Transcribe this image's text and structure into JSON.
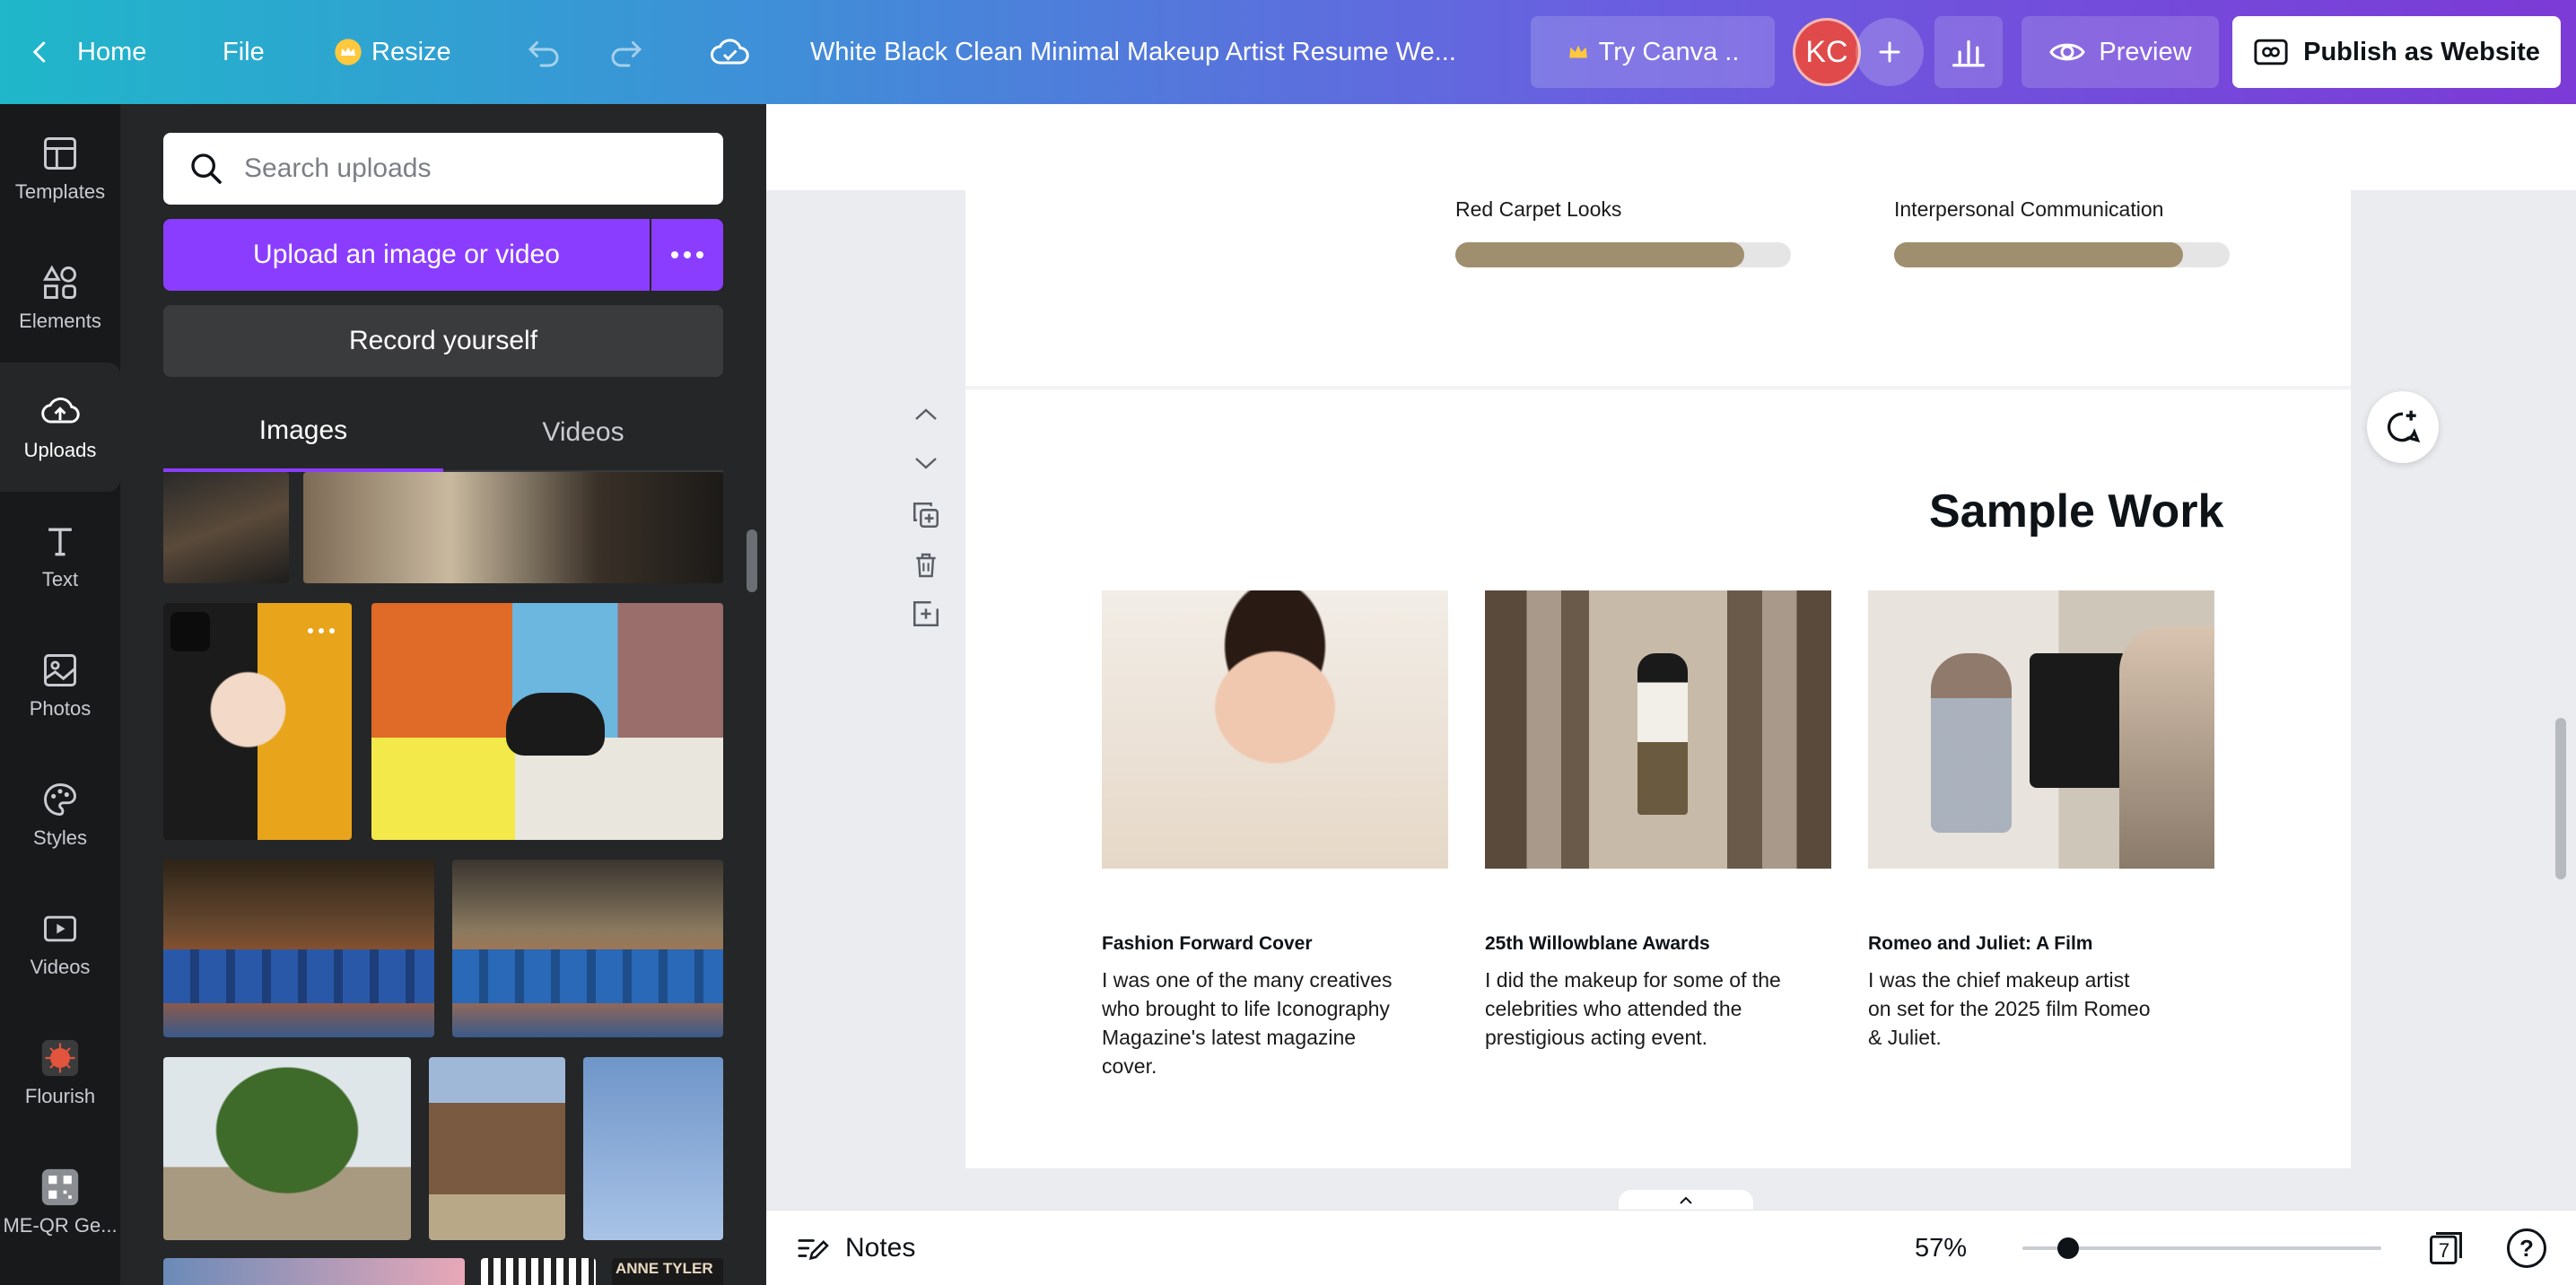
{
  "topbar": {
    "home_label": "Home",
    "file_label": "File",
    "resize_label": "Resize",
    "title": "White Black Clean Minimal Makeup Artist Resume We...",
    "try_label": "Try Canva ..",
    "avatar_initials": "KC",
    "preview_label": "Preview",
    "publish_label": "Publish as Website"
  },
  "rail": {
    "items": [
      {
        "label": "Templates",
        "icon": "templates-icon"
      },
      {
        "label": "Elements",
        "icon": "elements-icon"
      },
      {
        "label": "Uploads",
        "icon": "uploads-icon"
      },
      {
        "label": "Text",
        "icon": "text-icon"
      },
      {
        "label": "Photos",
        "icon": "photos-icon"
      },
      {
        "label": "Styles",
        "icon": "styles-icon"
      },
      {
        "label": "Videos",
        "icon": "videos-icon"
      },
      {
        "label": "Flourish",
        "icon": "flourish-icon"
      },
      {
        "label": "ME-QR Ge...",
        "icon": "meqr-icon"
      }
    ],
    "active": "Uploads"
  },
  "panel": {
    "search_placeholder": "Search uploads",
    "upload_label": "Upload an image or video",
    "record_label": "Record yourself",
    "tabs": [
      "Images",
      "Videos"
    ],
    "active_tab": "Images",
    "gallery_overlay_text": "ANNE TYLER"
  },
  "canvas": {
    "skills": [
      {
        "label": "Red Carpet Looks",
        "level": 0.86
      },
      {
        "label": "Interpersonal Communication",
        "level": 0.86
      }
    ],
    "section_title": "Sample Work",
    "works": [
      {
        "title": "Fashion Forward Cover",
        "desc": "I was one of the many creatives who brought to life Iconography Magazine's latest magazine cover."
      },
      {
        "title": "25th Willowblane Awards",
        "desc": "I did the makeup for some of the celebrities who attended the prestigious acting event."
      },
      {
        "title": "Romeo and Juliet: A Film",
        "desc": "I was the chief makeup artist on set for the 2025 film Romeo & Juliet."
      }
    ]
  },
  "bottombar": {
    "notes_label": "Notes",
    "zoom": "57%",
    "zoom_level": 0.57,
    "page_count": "7",
    "help_label": "?"
  },
  "colors": {
    "brand_purple": "#8b3dff",
    "skill_bar": "#a08f6e",
    "avatar": "#e04a4a"
  }
}
